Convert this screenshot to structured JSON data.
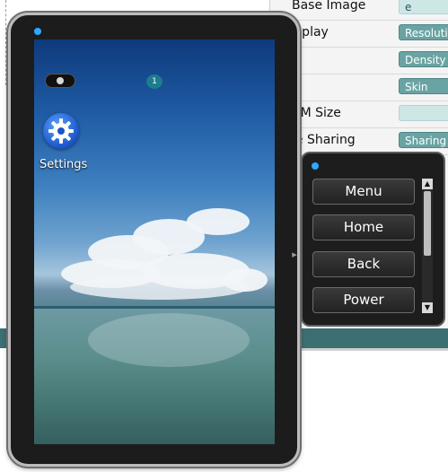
{
  "config": {
    "rows": [
      {
        "label": "Base Image",
        "button": "e",
        "style": "light"
      },
      {
        "label": "isplay",
        "button": "Resolution",
        "style": "normal"
      },
      {
        "label": "",
        "button": "Density",
        "style": "normal"
      },
      {
        "label": "",
        "button": "Skin",
        "style": "normal"
      },
      {
        "label": "AM Size",
        "button": "",
        "style": "light"
      },
      {
        "label": "le Sharing",
        "button": "Sharing",
        "style": "normal"
      }
    ]
  },
  "device": {
    "notification_count": "1",
    "apps": [
      {
        "label": "Settings",
        "icon": "gear-icon"
      }
    ]
  },
  "controls": {
    "buttons": [
      "Menu",
      "Home",
      "Back",
      "Power"
    ]
  },
  "colors": {
    "accent": "#2ea8ff",
    "config_button": "#6aa3a3",
    "footer_bar": "#3b6f72"
  }
}
